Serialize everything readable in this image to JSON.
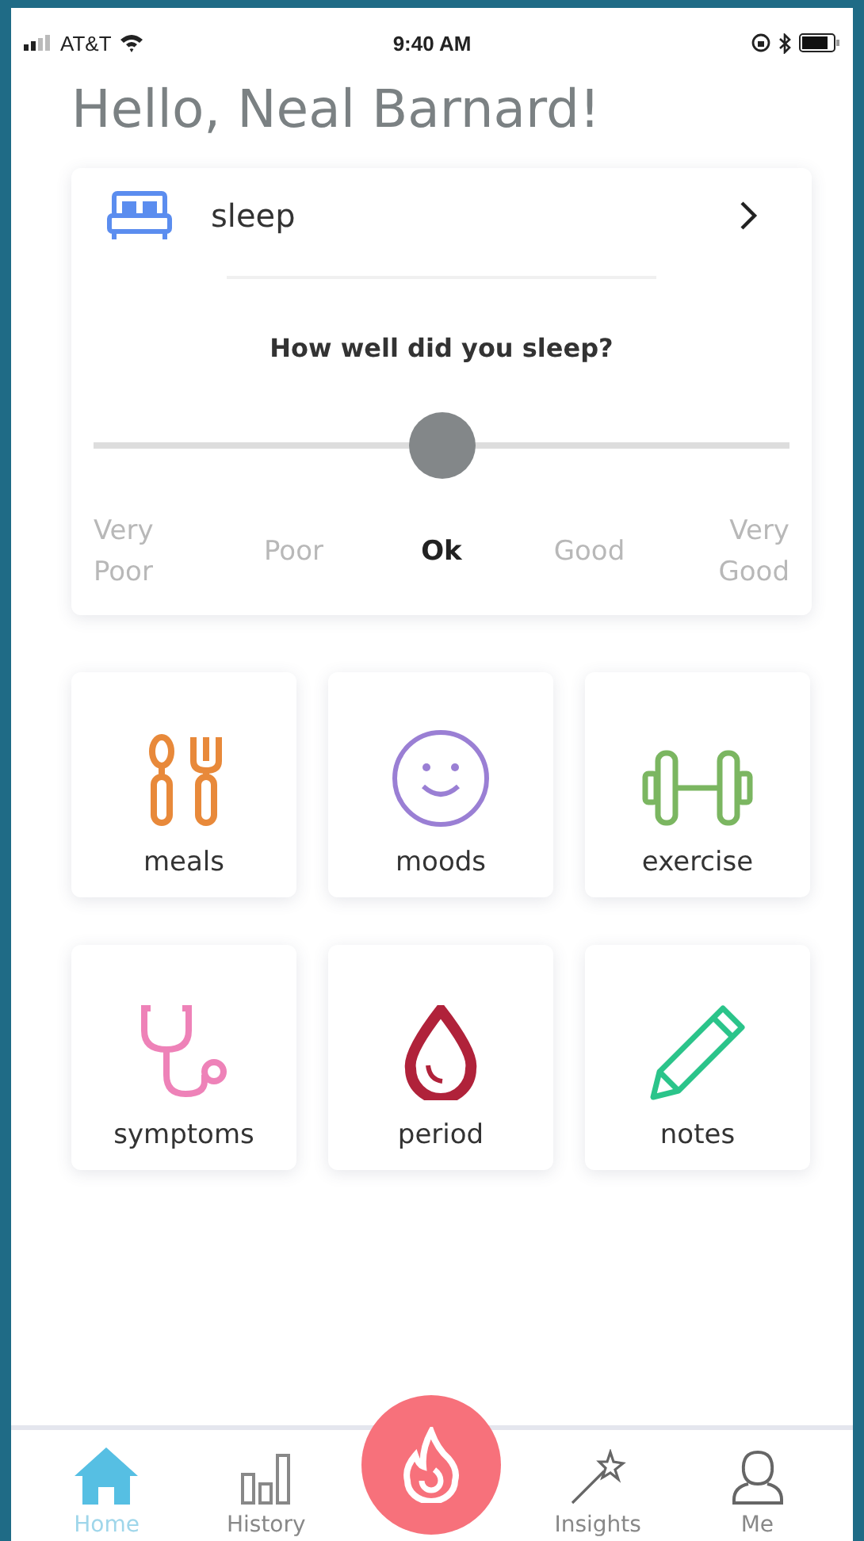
{
  "status_bar": {
    "carrier": "AT&T",
    "time": "9:40 AM"
  },
  "greeting": "Hello, Neal Barnard!",
  "sleep_card": {
    "title": "sleep",
    "question": "How well did you sleep?",
    "level": 0.5,
    "options": [
      {
        "label": "Very Poor",
        "selected": false
      },
      {
        "label": "Poor",
        "selected": false
      },
      {
        "label": "Ok",
        "selected": true
      },
      {
        "label": "Good",
        "selected": false
      },
      {
        "label": "Very Good",
        "selected": false
      }
    ]
  },
  "tiles": [
    {
      "label": "meals",
      "kind": "meals",
      "color": "#e8893a"
    },
    {
      "label": "moods",
      "kind": "moods",
      "color": "#9a7fd4"
    },
    {
      "label": "exercise",
      "kind": "exercise",
      "color": "#7bb661"
    },
    {
      "label": "symptoms",
      "kind": "symptoms",
      "color": "#ee82b8"
    },
    {
      "label": "period",
      "kind": "period",
      "color": "#b0223a"
    },
    {
      "label": "notes",
      "kind": "notes",
      "color": "#2bc48a"
    }
  ],
  "tab_bar": [
    {
      "label": "Home",
      "kind": "home",
      "selected": true
    },
    {
      "label": "History",
      "kind": "history",
      "selected": false
    },
    {
      "kind": "fire",
      "selected": false
    },
    {
      "label": "Insights",
      "kind": "insights",
      "selected": false
    },
    {
      "label": "Me",
      "kind": "me",
      "selected": false
    }
  ]
}
